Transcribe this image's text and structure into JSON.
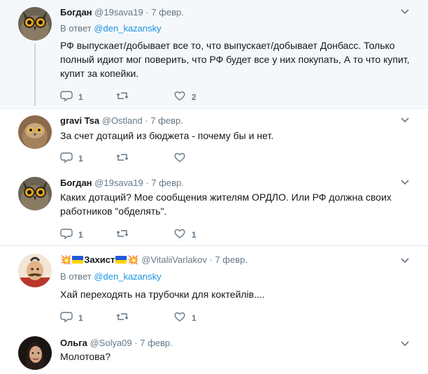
{
  "tweets": [
    {
      "name": "Богдан",
      "handle": "@19sava19",
      "date": "7 февр.",
      "reply_prefix": "В ответ",
      "reply_to": "@den_kazansky",
      "text": "РФ выпускает/добывает все то, что выпускает/добывает Донбасс. Только полный идиот мог поверить, что РФ будет все у них покупать, А то что купит, купит за копейки.",
      "replies": "1",
      "retweets": "",
      "likes": "2"
    },
    {
      "name": "gravi Tsa",
      "handle": "@Ostland",
      "date": "7 февр.",
      "text": "За счет дотаций из бюджета - почему бы и нет.",
      "replies": "1",
      "retweets": "",
      "likes": ""
    },
    {
      "name": "Богдан",
      "handle": "@19sava19",
      "date": "7 февр.",
      "text": "Каких дотаций? Мое сообщения жителям ОРДЛО. Или РФ должна своих работников \"обделять\".",
      "replies": "1",
      "retweets": "",
      "likes": "1"
    },
    {
      "name_prefix": "💥",
      "name": "Захист",
      "name_suffix": "💥",
      "handle": "@VitaliiVarlakov",
      "date": "7 февр.",
      "reply_prefix": "В ответ",
      "reply_to": "@den_kazansky",
      "text": "Хай переходять на трубочки для коктейлів....",
      "replies": "1",
      "retweets": "",
      "likes": "1"
    },
    {
      "name": "Ольга",
      "handle": "@Solya09",
      "date": "7 февр.",
      "text": "Молотова?"
    }
  ],
  "colors": {
    "link": "#1b95e0",
    "muted": "#657786",
    "highlight_bg": "#f5f8fa",
    "thread_line": "#ccd6dd"
  },
  "icons": {
    "reply": "reply-icon",
    "retweet": "retweet-icon",
    "like": "heart-icon",
    "menu": "chevron-down-icon"
  }
}
